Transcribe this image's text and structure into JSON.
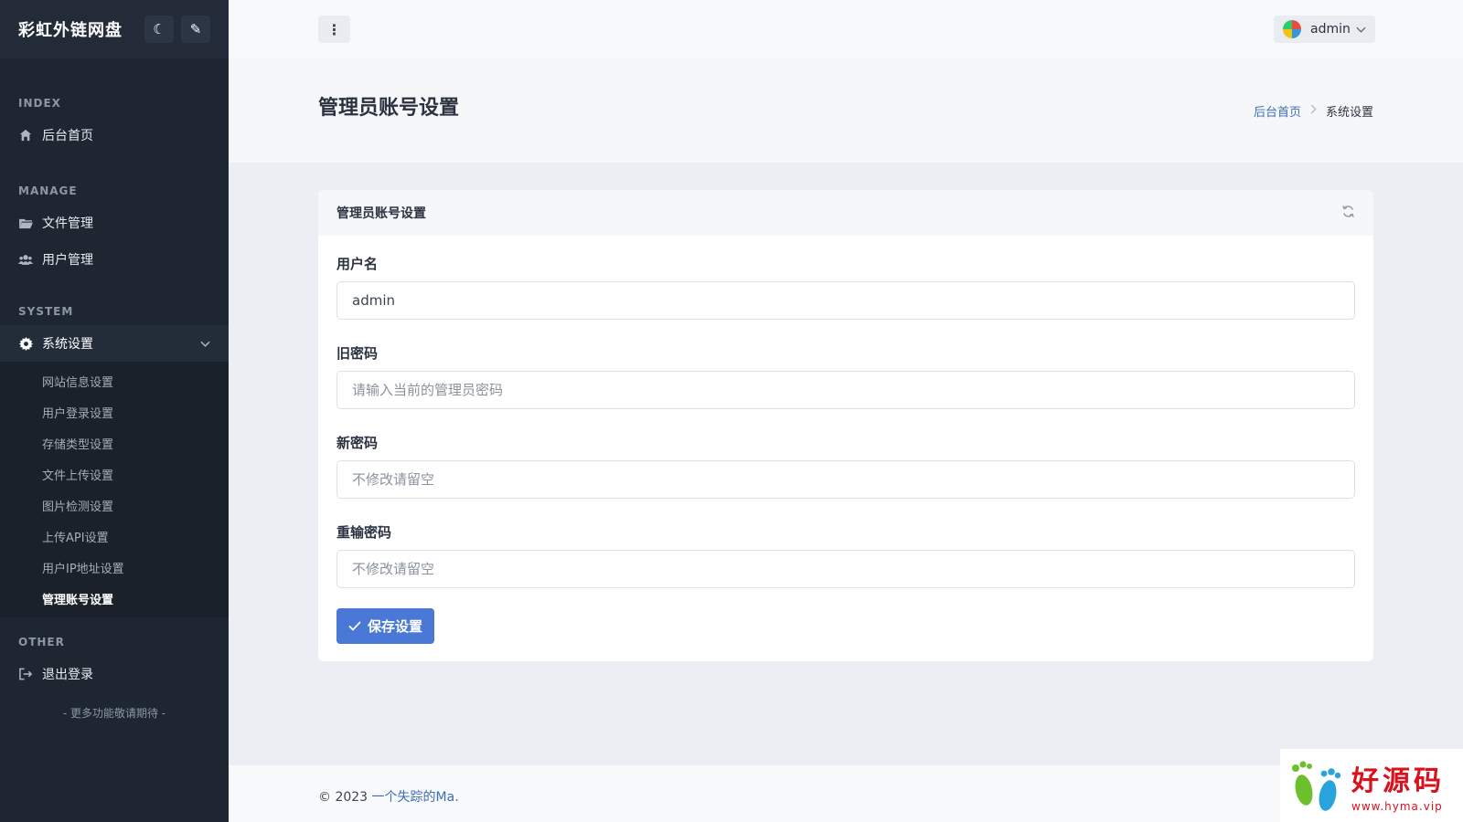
{
  "sidebar": {
    "brand": "彩虹外链网盘",
    "sections": [
      {
        "heading": "INDEX"
      },
      {
        "heading": "MANAGE"
      },
      {
        "heading": "SYSTEM"
      },
      {
        "heading": "OTHER"
      }
    ],
    "items": {
      "home": "后台首页",
      "files": "文件管理",
      "users": "用户管理",
      "system": "系统设置",
      "logout": "退出登录"
    },
    "sub_items": [
      "网站信息设置",
      "用户登录设置",
      "存储类型设置",
      "文件上传设置",
      "图片检测设置",
      "上传API设置",
      "用户IP地址设置",
      "管理账号设置"
    ],
    "more": "- 更多功能敬请期待 -"
  },
  "topbar": {
    "user": "admin"
  },
  "page": {
    "title": "管理员账号设置",
    "breadcrumb": {
      "home": "后台首页",
      "current": "系统设置"
    }
  },
  "card": {
    "title": "管理员账号设置",
    "fields": {
      "username": {
        "label": "用户名",
        "value": "admin"
      },
      "old_password": {
        "label": "旧密码",
        "placeholder": "请输入当前的管理员密码"
      },
      "new_password": {
        "label": "新密码",
        "placeholder": "不修改请留空"
      },
      "confirm_password": {
        "label": "重输密码",
        "placeholder": "不修改请留空"
      }
    },
    "save_label": "保存设置"
  },
  "footer": {
    "prefix": "© 2023 ",
    "link": "一个失踪的Ma."
  },
  "watermark": {
    "title": "好源码",
    "url": "www.hyma.vip"
  },
  "colors": {
    "sidebar_bg": "#1e2632",
    "accent": "#4a78d6",
    "link": "#3f6db3",
    "watermark": "#d9121e"
  }
}
